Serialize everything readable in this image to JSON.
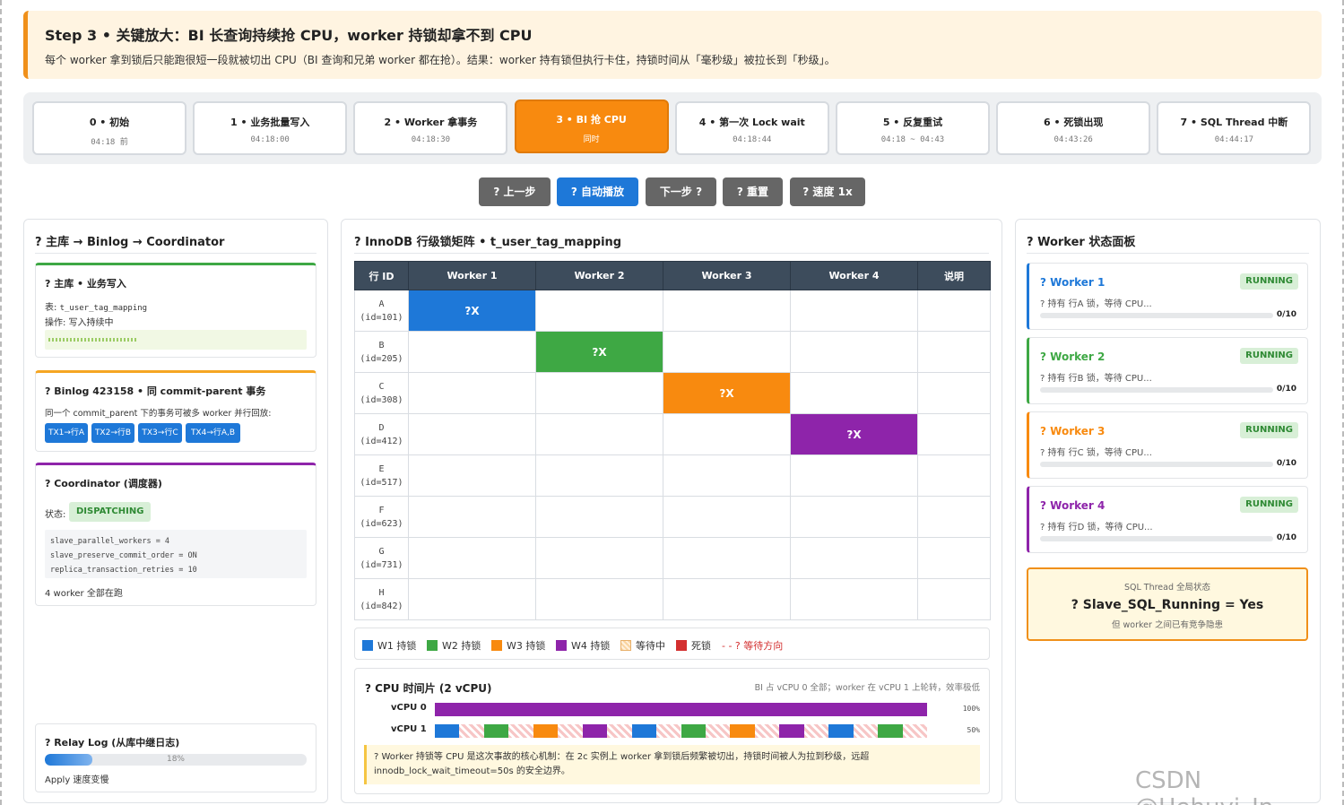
{
  "banner": {
    "title": "Step 3 • 关键放大：BI 长查询持续抢 CPU，worker 持锁却拿不到 CPU",
    "subtitle": "每个 worker 拿到锁后只能跑很短一段就被切出 CPU（BI 查询和兄弟 worker 都在抢）。结果：worker 持有锁但执行卡住，持锁时间从「毫秒级」被拉长到「秒级」。",
    "accent": "#f0901a"
  },
  "steps": [
    {
      "label": "0 • 初始",
      "time": "04:18 前"
    },
    {
      "label": "1 • 业务批量写入",
      "time": "04:18:00"
    },
    {
      "label": "2 • Worker 拿事务",
      "time": "04:18:30"
    },
    {
      "label": "3 • BI 抢 CPU",
      "time": "同时",
      "active": true
    },
    {
      "label": "4 • 第一次 Lock wait",
      "time": "04:18:44"
    },
    {
      "label": "5 • 反复重试",
      "time": "04:18 ~ 04:43"
    },
    {
      "label": "6 • 死锁出现",
      "time": "04:43:26"
    },
    {
      "label": "7 • SQL Thread 中断",
      "time": "04:44:17"
    }
  ],
  "controls": {
    "prev": "? 上一步",
    "auto": "? 自动播放",
    "next": "下一步 ?",
    "reset": "? 重置",
    "speed": "? 速度 1x"
  },
  "left": {
    "title": "? 主库 → Binlog → Coordinator",
    "master": {
      "title": "? 主库 • 业务写入",
      "table_label": "表: ",
      "table": "t_user_tag_mapping",
      "op": "操作: 写入持续中",
      "color": "#3ea844"
    },
    "binlog": {
      "title": "? Binlog 423158 • 同 commit-parent 事务",
      "desc": "同一个 commit_parent 下的事务可被多 worker 并行回放:",
      "chips": [
        "TX1→行A",
        "TX2→行B",
        "TX3→行C",
        "TX4→行A,B"
      ],
      "color": "#f5a623"
    },
    "coord": {
      "title": "? Coordinator (调度器)",
      "state_label": "状态:",
      "state": "DISPATCHING",
      "config": [
        "slave_parallel_workers = 4",
        "slave_preserve_commit_order = ON",
        "replica_transaction_retries = 10"
      ],
      "note": "4 worker 全部在跑",
      "color": "#8e24aa"
    },
    "relay": {
      "title": "? Relay Log (从库中继日志)",
      "progress": 0.18,
      "progress_text": "18%",
      "note": "Apply 速度变慢"
    }
  },
  "matrix": {
    "title": "? InnoDB 行级锁矩阵 • t_user_tag_mapping",
    "headers": [
      "行 ID",
      "Worker 1",
      "Worker 2",
      "Worker 3",
      "Worker 4",
      "说明"
    ],
    "rows": [
      {
        "id": "A",
        "sub": "(id=101)",
        "lock_col": 1,
        "lock": "?X",
        "color": "#1e78d8"
      },
      {
        "id": "B",
        "sub": "(id=205)",
        "lock_col": 2,
        "lock": "?X",
        "color": "#3ea844"
      },
      {
        "id": "C",
        "sub": "(id=308)",
        "lock_col": 3,
        "lock": "?X",
        "color": "#f88a0f"
      },
      {
        "id": "D",
        "sub": "(id=412)",
        "lock_col": 4,
        "lock": "?X",
        "color": "#8e24aa"
      },
      {
        "id": "E",
        "sub": "(id=517)"
      },
      {
        "id": "F",
        "sub": "(id=623)"
      },
      {
        "id": "G",
        "sub": "(id=731)"
      },
      {
        "id": "H",
        "sub": "(id=842)"
      }
    ],
    "legend": [
      {
        "label": "W1 持锁",
        "color": "#1e78d8"
      },
      {
        "label": "W2 持锁",
        "color": "#3ea844"
      },
      {
        "label": "W3 持锁",
        "color": "#f88a0f"
      },
      {
        "label": "W4 持锁",
        "color": "#8e24aa"
      },
      {
        "label": "等待中",
        "color": "#f9d4a0"
      },
      {
        "label": "死锁",
        "color": "#d32f2f"
      },
      {
        "label": "- - ? 等待方向",
        "color": "#d32f2f"
      }
    ]
  },
  "cpu": {
    "title": "? CPU 时间片 (2 vCPU)",
    "note": "BI 占 vCPU 0 全部；worker 在 vCPU 1 上轮转，效率极低",
    "rows": [
      {
        "label": "vCPU 0",
        "pct": "100%"
      },
      {
        "label": "vCPU 1",
        "pct": "50%"
      }
    ],
    "bi_color": "#8e24aa",
    "slices": [
      "#1e78d8",
      "wait",
      "#3ea844",
      "wait",
      "#f88a0f",
      "wait",
      "#8e24aa",
      "wait",
      "#1e78d8",
      "wait",
      "#3ea844",
      "wait",
      "#f88a0f",
      "wait",
      "#8e24aa",
      "wait",
      "#1e78d8",
      "wait",
      "#3ea844",
      "wait"
    ],
    "tip": "? Worker 持锁等 CPU 是这次事故的核心机制：在 2c 实例上 worker 拿到锁后频繁被切出，持锁时间被人为拉到秒级，远超 innodb_lock_wait_timeout=50s 的安全边界。"
  },
  "workers": {
    "title": "? Worker 状态面板",
    "items": [
      {
        "name": "? Worker 1",
        "badge": "RUNNING",
        "state": "? 持有 行A 锁，等待 CPU...",
        "count": "0/10",
        "color": "#1e78d8"
      },
      {
        "name": "? Worker 2",
        "badge": "RUNNING",
        "state": "? 持有 行B 锁，等待 CPU...",
        "count": "0/10",
        "color": "#3ea844"
      },
      {
        "name": "? Worker 3",
        "badge": "RUNNING",
        "state": "? 持有 行C 锁，等待 CPU...",
        "count": "0/10",
        "color": "#f88a0f"
      },
      {
        "name": "? Worker 4",
        "badge": "RUNNING",
        "state": "? 持有 行D 锁，等待 CPU...",
        "count": "0/10",
        "color": "#8e24aa"
      }
    ],
    "sql": {
      "label": "SQL Thread 全局状态",
      "value": "? Slave_SQL_Running = Yes",
      "note": "但 worker 之间已有竞争隐患"
    }
  },
  "watermark": "CSDN @Hehuyi_In"
}
